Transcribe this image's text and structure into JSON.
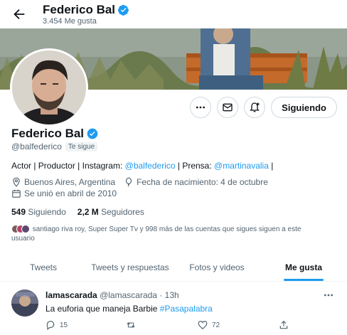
{
  "header": {
    "name": "Federico Bal",
    "likes_count": "3.454 Me gusta"
  },
  "actions": {
    "following_label": "Siguiendo"
  },
  "profile": {
    "name": "Federico Bal",
    "handle": "@balfederico",
    "follows_you": "Te sigue",
    "bio_part1": "Actor | Productor | Instagram: ",
    "bio_link1": "@balfederico",
    "bio_part2": " | Prensa: ",
    "bio_link2": "@martinavalia",
    "bio_part3": " |",
    "location": "Buenos Aires, Argentina",
    "birthday": "Fecha de nacimiento: 4 de octubre",
    "joined": "Se unió en abril de 2010",
    "following_count": "549",
    "following_label": "Siguiendo",
    "followers_count": "2,2 M",
    "followers_label": "Seguidores",
    "known_followers": "santiago riva roy, Super Super Tv y 998 más de las cuentas que sigues siguen a este usuario"
  },
  "tabs": [
    "Tweets",
    "Tweets y respuestas",
    "Fotos y videos",
    "Me gusta"
  ],
  "tweet": {
    "author_name": "lamascarada",
    "author_handle": "@lamascarada",
    "time": "· 13h",
    "text": "La euforia que maneja Barbie ",
    "hashtag": "#Pasapalabra",
    "reply_count": "15",
    "like_count": "72"
  },
  "colors": {
    "accent": "#1d9bf0",
    "secondary_text": "#536471",
    "primary_text": "#0f1419"
  }
}
